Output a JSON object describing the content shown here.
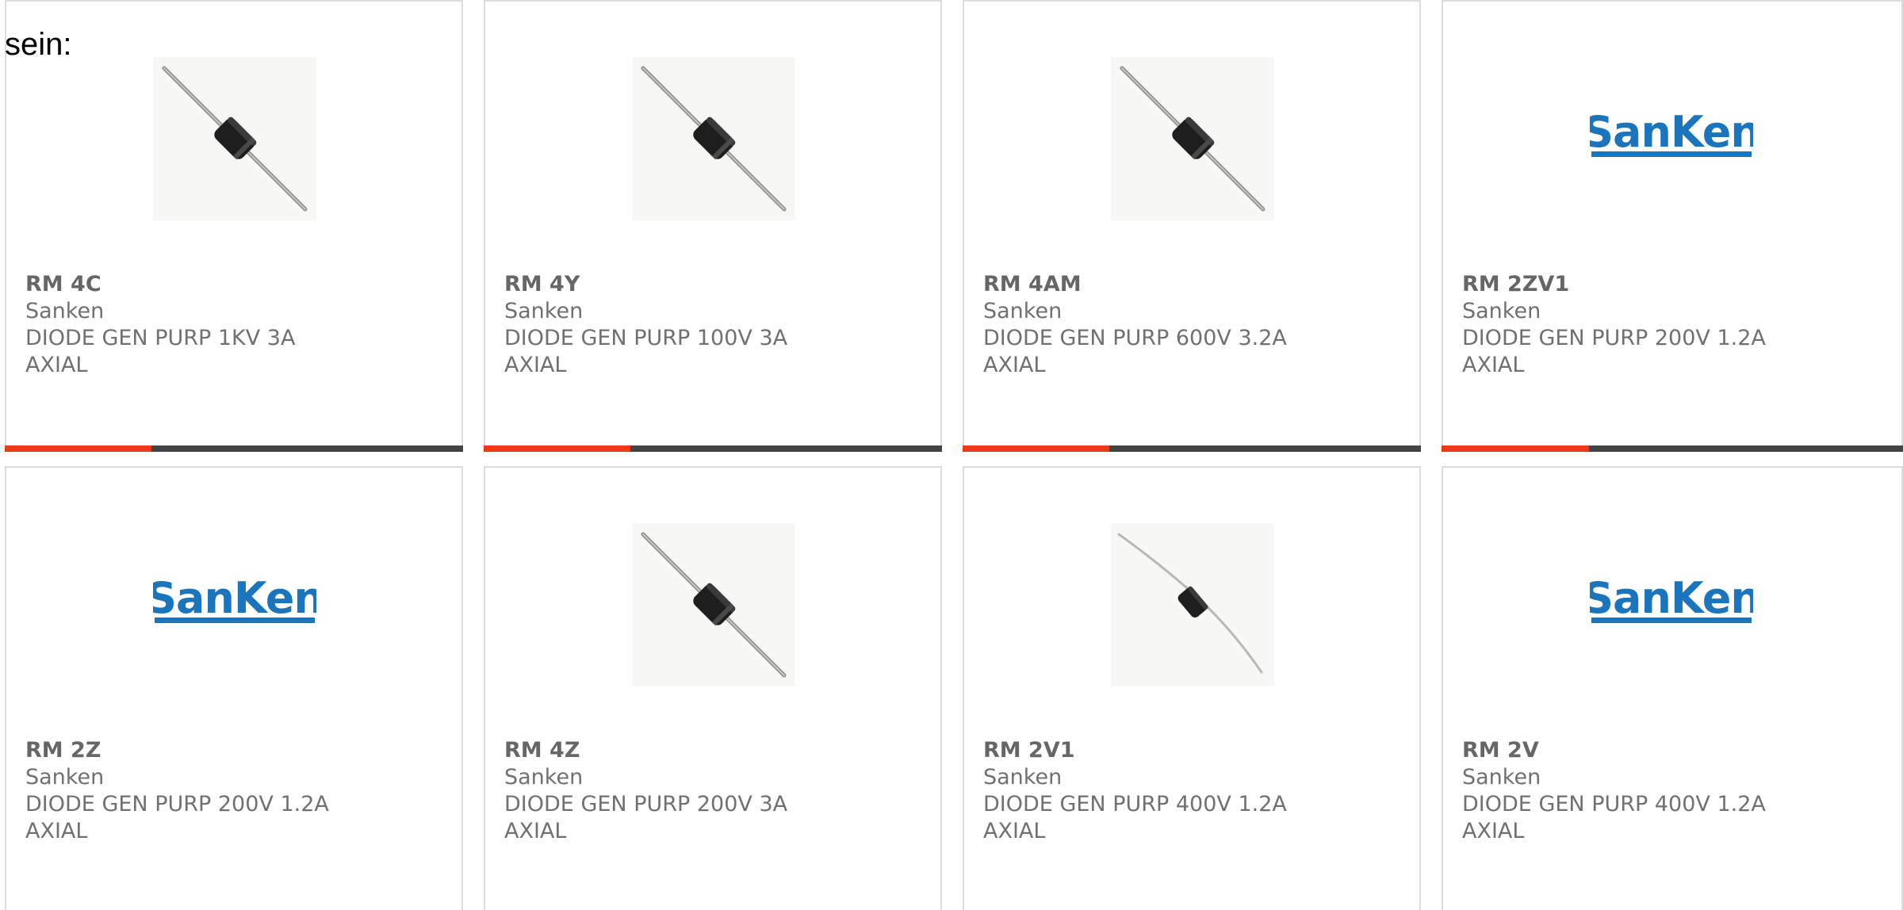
{
  "intro_text": "sein:",
  "colors": {
    "accent": "#ee3a12",
    "bar_dark": "#444444",
    "text": "#707070",
    "sanken_blue": "#1b75bc"
  },
  "products": [
    {
      "part": "RM 4C",
      "manufacturer": "Sanken",
      "description": "DIODE GEN PURP 1KV 3A AXIAL",
      "image": "diode-icon",
      "progress": 0.32
    },
    {
      "part": "RM 4Y",
      "manufacturer": "Sanken",
      "description": "DIODE GEN PURP 100V 3A AXIAL",
      "image": "diode-icon",
      "progress": 0.32
    },
    {
      "part": "RM 4AM",
      "manufacturer": "Sanken",
      "description": "DIODE GEN PURP 600V 3.2A AXIAL",
      "image": "diode-icon",
      "progress": 0.32
    },
    {
      "part": "RM 2ZV1",
      "manufacturer": "Sanken",
      "description": "DIODE GEN PURP 200V 1.2A AXIAL",
      "image": "sanken-logo",
      "logo_text": "SanKen",
      "progress": 0.32
    },
    {
      "part": "RM 2Z",
      "manufacturer": "Sanken",
      "description": "DIODE GEN PURP 200V 1.2A AXIAL",
      "image": "sanken-logo",
      "logo_text": "SanKen"
    },
    {
      "part": "RM 4Z",
      "manufacturer": "Sanken",
      "description": "DIODE GEN PURP 200V 3A AXIAL",
      "image": "diode-icon"
    },
    {
      "part": "RM 2V1",
      "manufacturer": "Sanken",
      "description": "DIODE GEN PURP 400V 1.2A AXIAL",
      "image": "diode-thin-icon"
    },
    {
      "part": "RM 2V",
      "manufacturer": "Sanken",
      "description": "DIODE GEN PURP 400V 1.2A AXIAL",
      "image": "sanken-logo",
      "logo_text": "SanKen"
    }
  ]
}
